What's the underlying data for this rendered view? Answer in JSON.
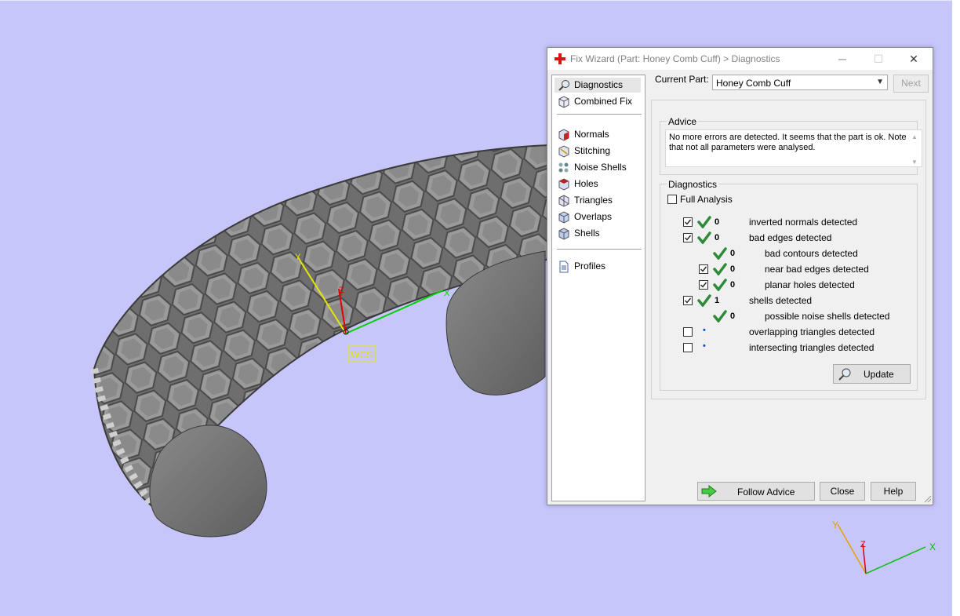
{
  "window": {
    "title": "Fix Wizard (Part: Honey Comb Cuff) > Diagnostics",
    "minimize": "─",
    "maximize": "☐",
    "close": "✕"
  },
  "nav": {
    "items": [
      {
        "label": "Diagnostics",
        "icon": "magnifier-icon"
      },
      {
        "label": "Combined Fix",
        "icon": "cube-icon"
      },
      {
        "label": "Normals",
        "icon": "normals-cube-icon"
      },
      {
        "label": "Stitching",
        "icon": "stitching-cube-icon"
      },
      {
        "label": "Noise Shells",
        "icon": "noise-shells-icon"
      },
      {
        "label": "Holes",
        "icon": "holes-cube-icon"
      },
      {
        "label": "Triangles",
        "icon": "triangles-cube-icon"
      },
      {
        "label": "Overlaps",
        "icon": "overlaps-cube-icon"
      },
      {
        "label": "Shells",
        "icon": "shells-cube-icon"
      },
      {
        "label": "Profiles",
        "icon": "profiles-document-icon"
      }
    ]
  },
  "part": {
    "label": "Current Part:",
    "value": "Honey Comb Cuff",
    "next": "Next"
  },
  "advice": {
    "title": "Advice",
    "text": "No more errors are detected. It seems that the part is ok. Note that not all parameters were analysed."
  },
  "diagnostics": {
    "title": "Diagnostics",
    "full_analysis": "Full Analysis",
    "rows": [
      {
        "count": "0",
        "label": "inverted normals detected"
      },
      {
        "count": "0",
        "label": "bad edges detected"
      },
      {
        "count": "0",
        "label": "bad contours detected"
      },
      {
        "count": "0",
        "label": "near bad edges detected"
      },
      {
        "count": "0",
        "label": "planar holes detected"
      },
      {
        "count": "1",
        "label": "shells detected"
      },
      {
        "count": "0",
        "label": "possible noise shells detected"
      },
      {
        "count": "•",
        "label": "overlapping triangles detected"
      },
      {
        "count": "•",
        "label": "intersecting triangles detected"
      }
    ],
    "update": "Update"
  },
  "footer": {
    "follow_advice": "Follow Advice",
    "close": "Close",
    "help": "Help"
  },
  "viewport": {
    "wcs_label": "WCS",
    "axis_x": "X",
    "axis_y": "Y",
    "axis_z": "Z",
    "background_color": "#c6c6fa",
    "accent_green": "#2e8b3a"
  }
}
